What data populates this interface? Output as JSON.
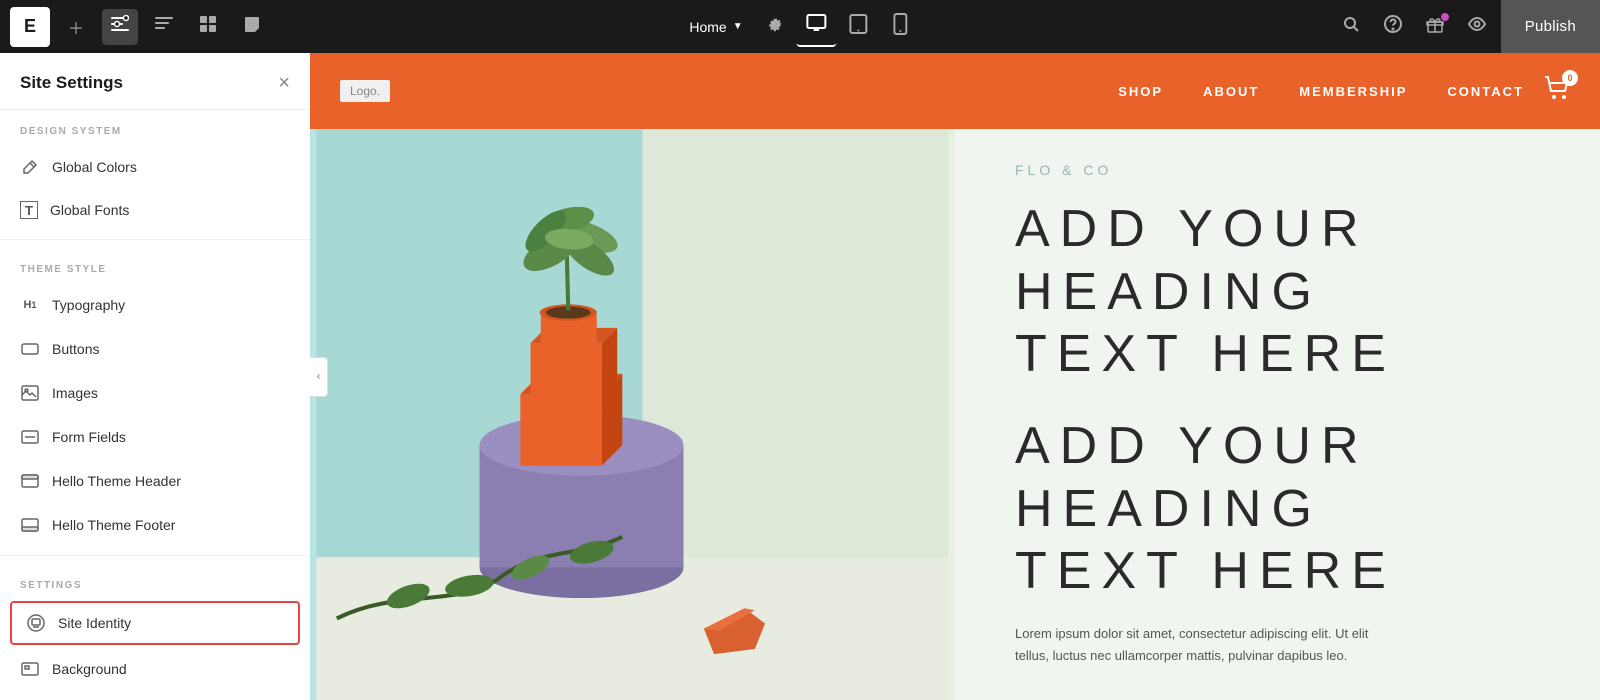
{
  "toolbar": {
    "logo_letter": "E",
    "home_label": "Home",
    "publish_label": "Publish"
  },
  "sidebar": {
    "title": "Site Settings",
    "close_label": "×",
    "sections": [
      {
        "label": "DESIGN SYSTEM",
        "items": [
          {
            "id": "global-colors",
            "label": "Global Colors",
            "icon": "✏"
          },
          {
            "id": "global-fonts",
            "label": "Global Fonts",
            "icon": "T"
          }
        ]
      },
      {
        "label": "THEME STYLE",
        "items": [
          {
            "id": "typography",
            "label": "Typography",
            "icon": "H₁"
          },
          {
            "id": "buttons",
            "label": "Buttons",
            "icon": "▭"
          },
          {
            "id": "images",
            "label": "Images",
            "icon": "⊞"
          },
          {
            "id": "form-fields",
            "label": "Form Fields",
            "icon": "⬜"
          },
          {
            "id": "hello-theme-header",
            "label": "Hello Theme Header",
            "icon": "▭"
          },
          {
            "id": "hello-theme-footer",
            "label": "Hello Theme Footer",
            "icon": "▭"
          }
        ]
      },
      {
        "label": "SETTINGS",
        "items": [
          {
            "id": "site-identity",
            "label": "Site Identity",
            "icon": "⚙",
            "active": true
          },
          {
            "id": "background",
            "label": "Background",
            "icon": "▭"
          }
        ]
      }
    ]
  },
  "site_preview": {
    "navbar": {
      "logo": "Logo.",
      "nav_items": [
        "SHOP",
        "ABOUT",
        "MEMBERSHIP",
        "CONTACT"
      ],
      "cart_count": "0"
    },
    "hero": {
      "brand": "FLO & CO",
      "heading1_line1": "ADD YOUR",
      "heading1_line2": "HEADING",
      "heading1_line3": "TEXT HERE",
      "heading2_line1": "ADD YOUR",
      "heading2_line2": "HEADING",
      "heading2_line3": "TEXT HERE",
      "body_text": "Lorem ipsum dolor sit amet, consectetur adipiscing elit. Ut elit tellus, luctus nec ullamcorper mattis, pulvinar dapibus leo."
    }
  },
  "colors": {
    "navbar_bg": "#e8622a",
    "hero_right_bg": "#f0f5f0",
    "brand_color": "#9ab5b0",
    "heading_color": "#2a2a2a",
    "active_border": "#e44444"
  }
}
